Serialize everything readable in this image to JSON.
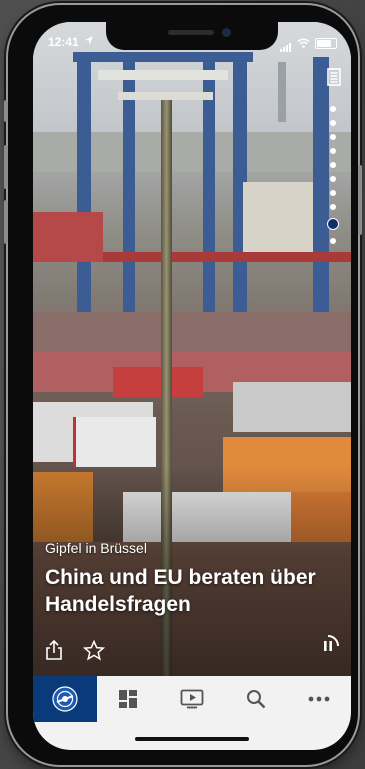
{
  "status_bar": {
    "time": "12:41"
  },
  "teaser": {
    "subtitle": "Gipfel in Brüssel",
    "title": "China und EU beraten über Handelsfragen"
  },
  "pager": {
    "count": 10,
    "active_index": 8
  },
  "tabbar": {
    "items": [
      {
        "icon": "tagesschau-logo-icon",
        "active": true
      },
      {
        "icon": "grid-icon",
        "active": false
      },
      {
        "icon": "play-video-icon",
        "active": false
      },
      {
        "icon": "search-icon",
        "active": false
      },
      {
        "icon": "more-icon",
        "active": false
      }
    ]
  },
  "colors": {
    "accent": "#0a3a7a",
    "tabbar_bg": "#f2f2f2"
  }
}
